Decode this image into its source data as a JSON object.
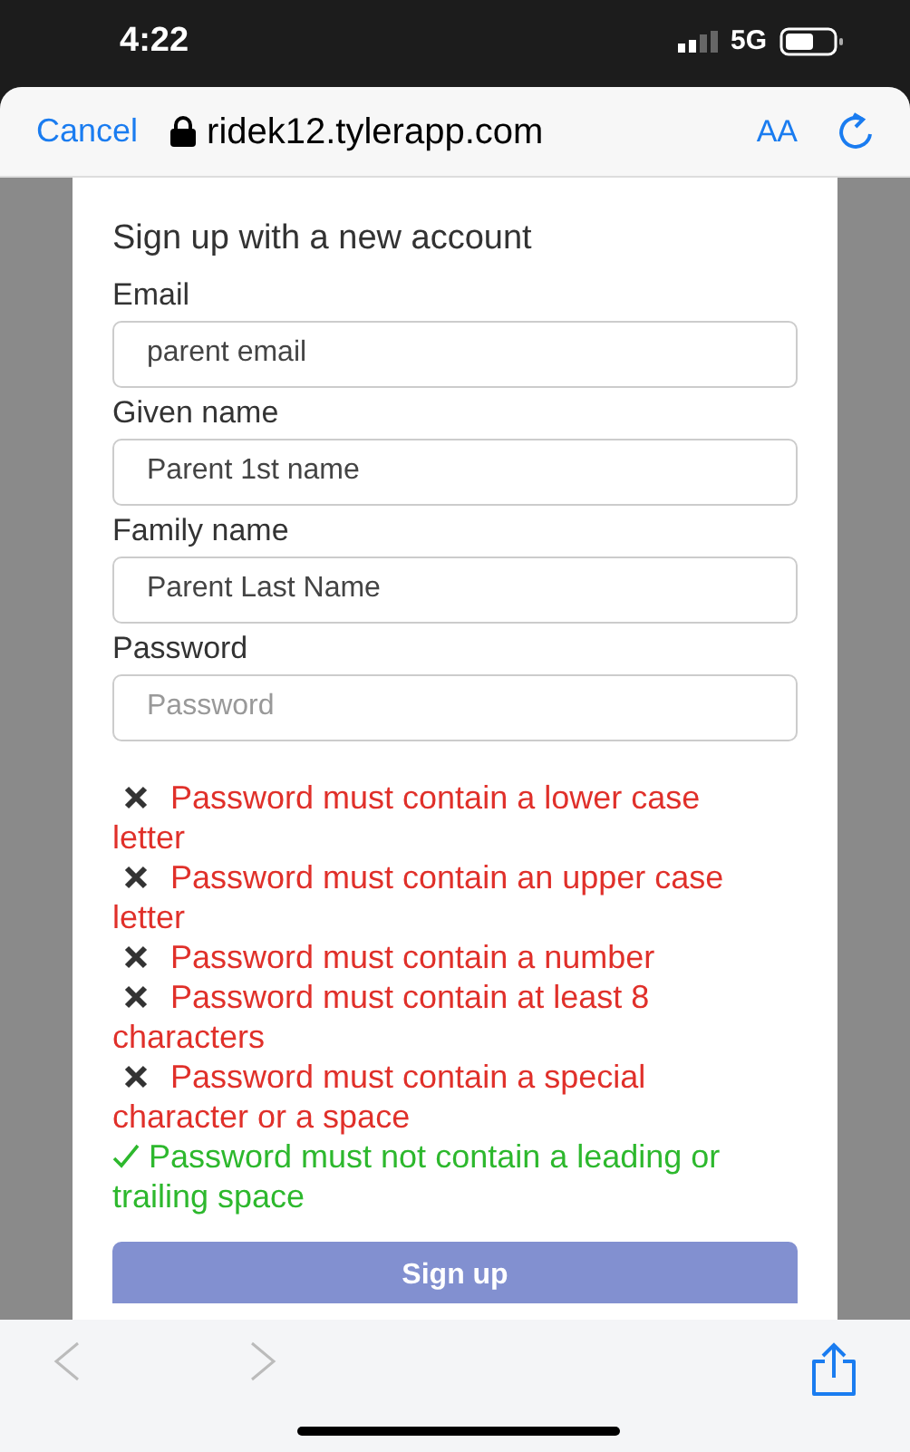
{
  "status_bar": {
    "time": "4:22",
    "network": "5G"
  },
  "browser_bar": {
    "cancel": "Cancel",
    "url": "ridek12.tylerapp.com",
    "text_size": "AA"
  },
  "form": {
    "title": "Sign up with a new account",
    "fields": [
      {
        "label": "Email",
        "value": "parent email"
      },
      {
        "label": "Given name",
        "value": "Parent 1st name"
      },
      {
        "label": "Family name",
        "value": "Parent Last Name"
      },
      {
        "label": "Password",
        "placeholder": "Password"
      }
    ],
    "rules": [
      {
        "text": "Password must contain a lower case letter",
        "met": false
      },
      {
        "text": "Password must contain an upper case letter",
        "met": false
      },
      {
        "text": "Password must contain a number",
        "met": false
      },
      {
        "text": "Password must contain at least 8 characters",
        "met": false
      },
      {
        "text": "Password must contain a special character or a space",
        "met": false
      },
      {
        "text": "Password must not contain a leading or trailing space",
        "met": true
      }
    ],
    "submit": "Sign up"
  },
  "toolbar": {
    "back_disabled": true,
    "forward_disabled": true
  }
}
